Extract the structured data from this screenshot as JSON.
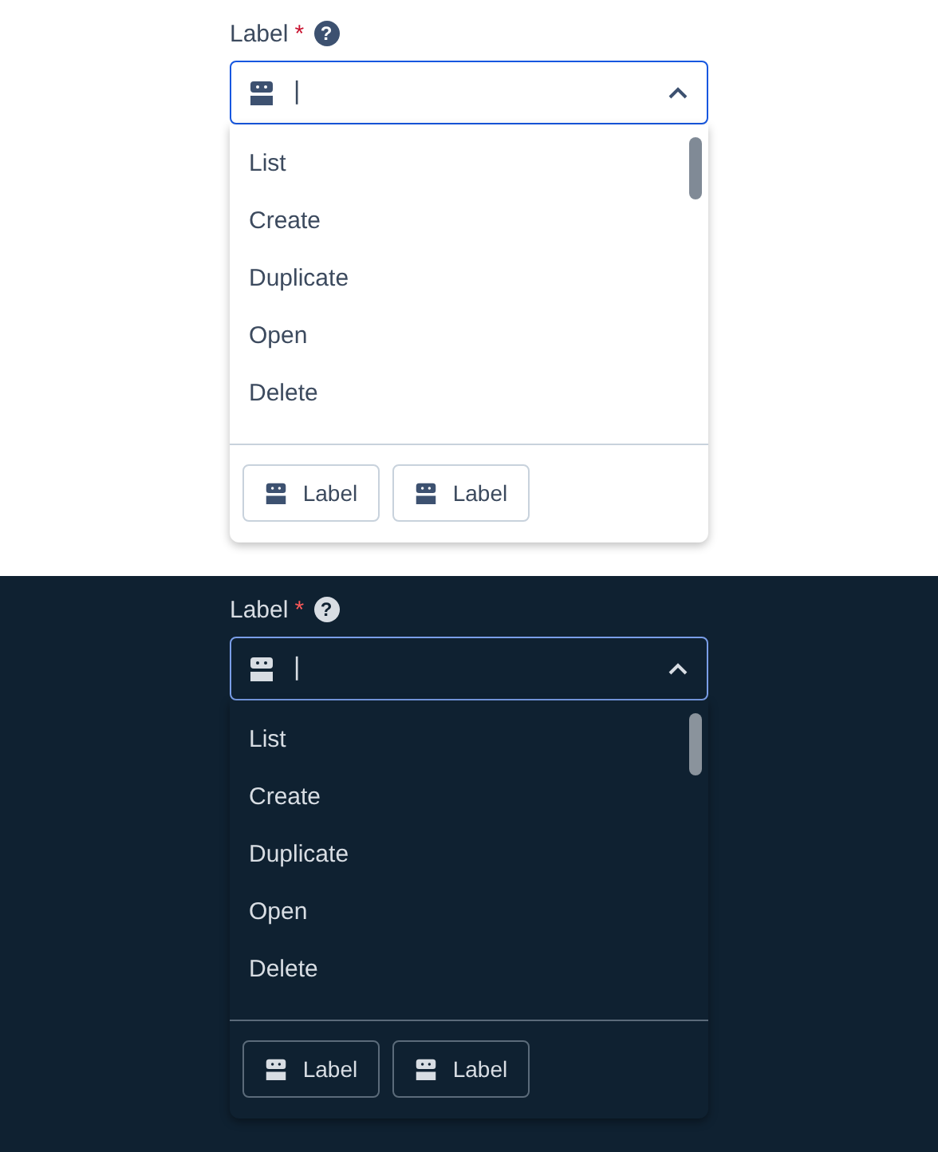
{
  "panels": [
    {
      "kind": "light",
      "label": "Label",
      "required": "*",
      "help": "?",
      "input": {
        "value": "|",
        "expanded": true
      },
      "options": [
        {
          "label": "List"
        },
        {
          "label": "Create"
        },
        {
          "label": "Duplicate"
        },
        {
          "label": "Open"
        },
        {
          "label": "Delete"
        }
      ],
      "footer_buttons": [
        {
          "label": "Label"
        },
        {
          "label": "Label"
        }
      ]
    },
    {
      "kind": "dark",
      "label": "Label",
      "required": "*",
      "help": "?",
      "input": {
        "value": "|",
        "expanded": true
      },
      "options": [
        {
          "label": "List"
        },
        {
          "label": "Create"
        },
        {
          "label": "Duplicate"
        },
        {
          "label": "Open"
        },
        {
          "label": "Delete"
        }
      ],
      "footer_buttons": [
        {
          "label": "Label"
        },
        {
          "label": "Label"
        }
      ]
    }
  ]
}
